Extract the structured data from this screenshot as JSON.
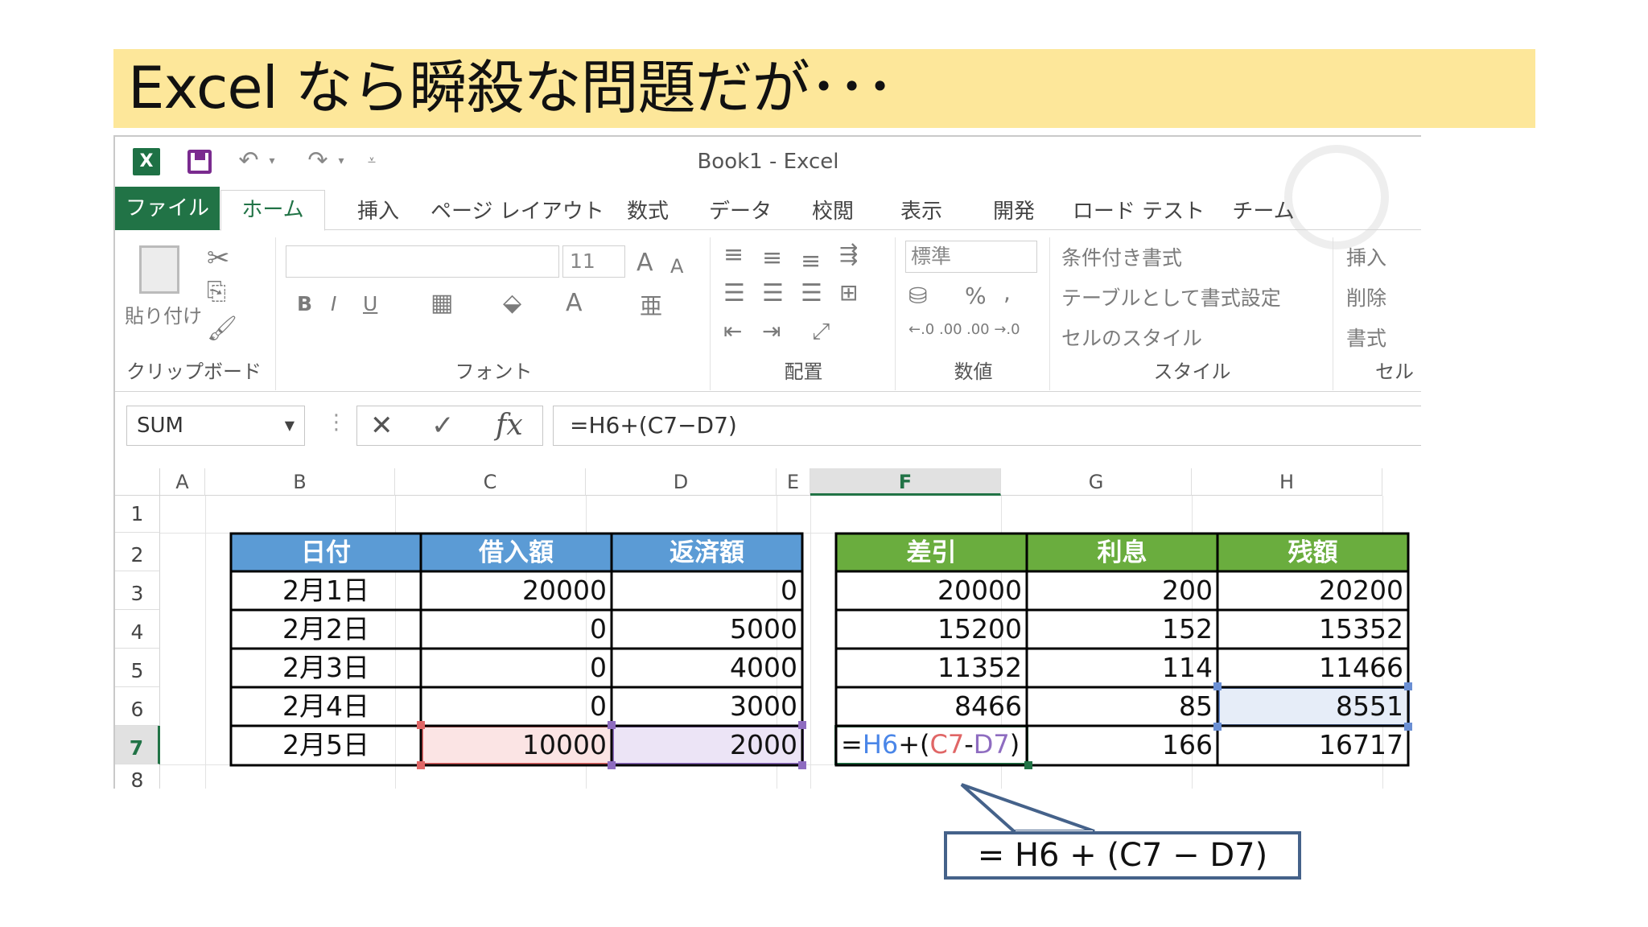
{
  "slide": {
    "title": "Excel なら瞬殺な問題だが･･･"
  },
  "window": {
    "title": "Book1 - Excel"
  },
  "tabs": [
    "ファイル",
    "ホーム",
    "挿入",
    "ページ レイアウト",
    "数式",
    "データ",
    "校閲",
    "表示",
    "開発",
    "ロード テスト",
    "チーム"
  ],
  "ribbon": {
    "clipboard": {
      "label": "クリップボード",
      "paste": "貼り付け"
    },
    "font": {
      "label": "フォント",
      "size": "11",
      "bold": "B",
      "italic": "I",
      "underline": "U",
      "grow": "A",
      "shrink": "A",
      "color": "A"
    },
    "alignment": {
      "label": "配置"
    },
    "number": {
      "label": "数値",
      "format": "標準",
      "percent": "%",
      "comma": ",",
      "inc": "←.0 .00",
      "dec": ".00 →.0"
    },
    "styles": {
      "label": "スタイル",
      "conditional": "条件付き書式",
      "table": "テーブルとして書式設定",
      "cell": "セルのスタイル"
    },
    "cells": {
      "label": "セル",
      "insert": "挿入",
      "delete": "削除",
      "format": "書式"
    }
  },
  "formula_bar": {
    "name_box": "SUM",
    "fx": "fx",
    "formula": "=H6+(C7−D7)"
  },
  "columns": [
    "A",
    "B",
    "C",
    "D",
    "E",
    "F",
    "G",
    "H"
  ],
  "rows": [
    "1",
    "2",
    "3",
    "4",
    "5",
    "6",
    "7",
    "8"
  ],
  "table_left": {
    "headers": [
      "日付",
      "借入額",
      "返済額"
    ],
    "rows": [
      [
        "2月1日",
        "20000",
        "0"
      ],
      [
        "2月2日",
        "0",
        "5000"
      ],
      [
        "2月3日",
        "0",
        "4000"
      ],
      [
        "2月4日",
        "0",
        "3000"
      ],
      [
        "2月5日",
        "10000",
        "2000"
      ]
    ]
  },
  "table_right": {
    "headers": [
      "差引",
      "利息",
      "残額"
    ],
    "rows": [
      [
        "20000",
        "200",
        "20200"
      ],
      [
        "15200",
        "152",
        "15352"
      ],
      [
        "11352",
        "114",
        "11466"
      ],
      [
        "8466",
        "85",
        "8551"
      ],
      [
        "",
        "166",
        "16717"
      ]
    ]
  },
  "editing_formula": {
    "eq": "=",
    "ref1": "H6",
    "plus": "+(",
    "ref2": "C7",
    "minus": "-",
    "ref3": "D7",
    "close": ")"
  },
  "callout": {
    "text": "= H6 + (C7 − D7)"
  },
  "colors": {
    "header_blue": "#5b9bd5",
    "header_green": "#6aad3e",
    "excel_green": "#217346",
    "ref_blue": "#4a86e8",
    "ref_red": "#e06666",
    "ref_purple": "#8e6cc0"
  }
}
